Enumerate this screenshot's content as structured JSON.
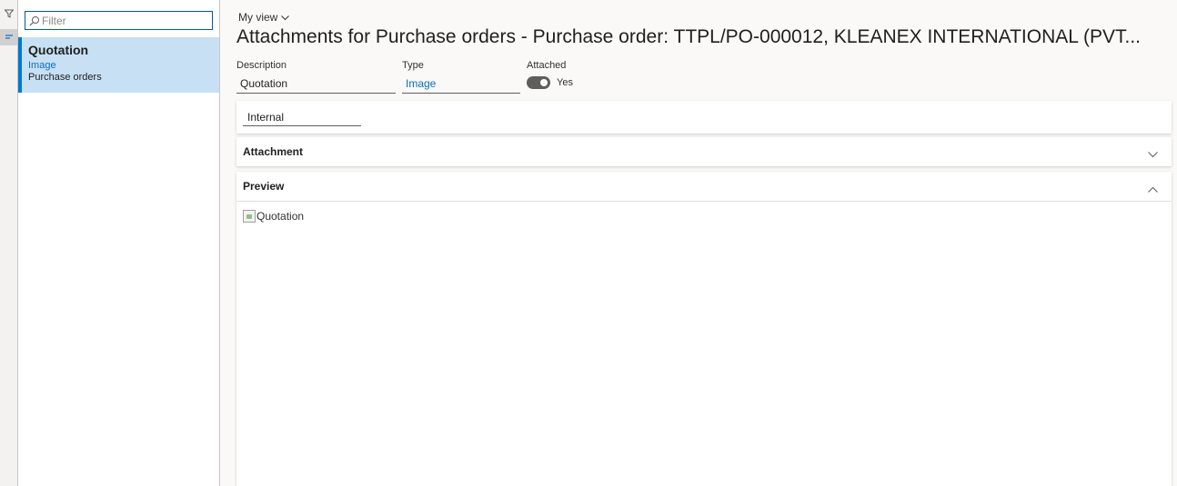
{
  "filter": {
    "placeholder": "Filter"
  },
  "list": {
    "items": [
      {
        "title": "Quotation",
        "type": "Image",
        "subtitle": "Purchase orders"
      }
    ]
  },
  "header": {
    "my_view_label": "My view",
    "title": "Attachments for Purchase orders - Purchase order: TTPL/PO-000012, KLEANEX INTERNATIONAL (PVT..."
  },
  "fields": {
    "description": {
      "label": "Description",
      "value": "Quotation"
    },
    "type": {
      "label": "Type",
      "value": "Image"
    },
    "attached": {
      "label": "Attached",
      "value": "Yes",
      "on": true
    }
  },
  "restriction": {
    "value": "Internal"
  },
  "sections": {
    "attachment": {
      "label": "Attachment",
      "expanded": false
    },
    "preview": {
      "label": "Preview",
      "expanded": true,
      "image_alt": "Quotation"
    }
  },
  "icons": {
    "rail": [
      "filter-icon",
      "list-icon"
    ],
    "filter": "search-icon"
  },
  "colors": {
    "accent": "#0078d4",
    "selected_bg": "#c7e0f4",
    "link": "#0f6cbd"
  }
}
